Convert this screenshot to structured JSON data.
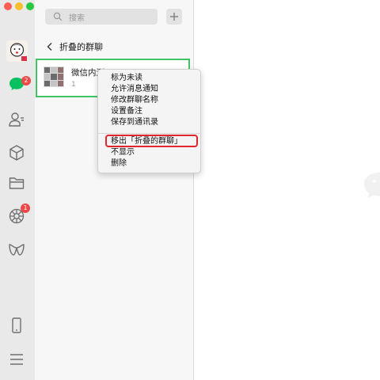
{
  "search": {
    "placeholder": "搜索"
  },
  "sidebar": {
    "chats_badge": "2",
    "moments_badge": "1"
  },
  "folded": {
    "title": "折叠的群聊"
  },
  "chat": {
    "name": "微信内测",
    "preview": "1"
  },
  "context_menu": {
    "items": [
      "标为未读",
      "允许消息通知",
      "修改群聊名称",
      "设置备注",
      "保存到通讯录",
      "移出「折叠的群聊」",
      "不显示",
      "删除"
    ],
    "highlighted_item": "移出「折叠的群聊」"
  },
  "colors": {
    "accent": "#07c160",
    "badge": "#f04848",
    "highlight": "#e0262a",
    "selection": "#41c463"
  }
}
